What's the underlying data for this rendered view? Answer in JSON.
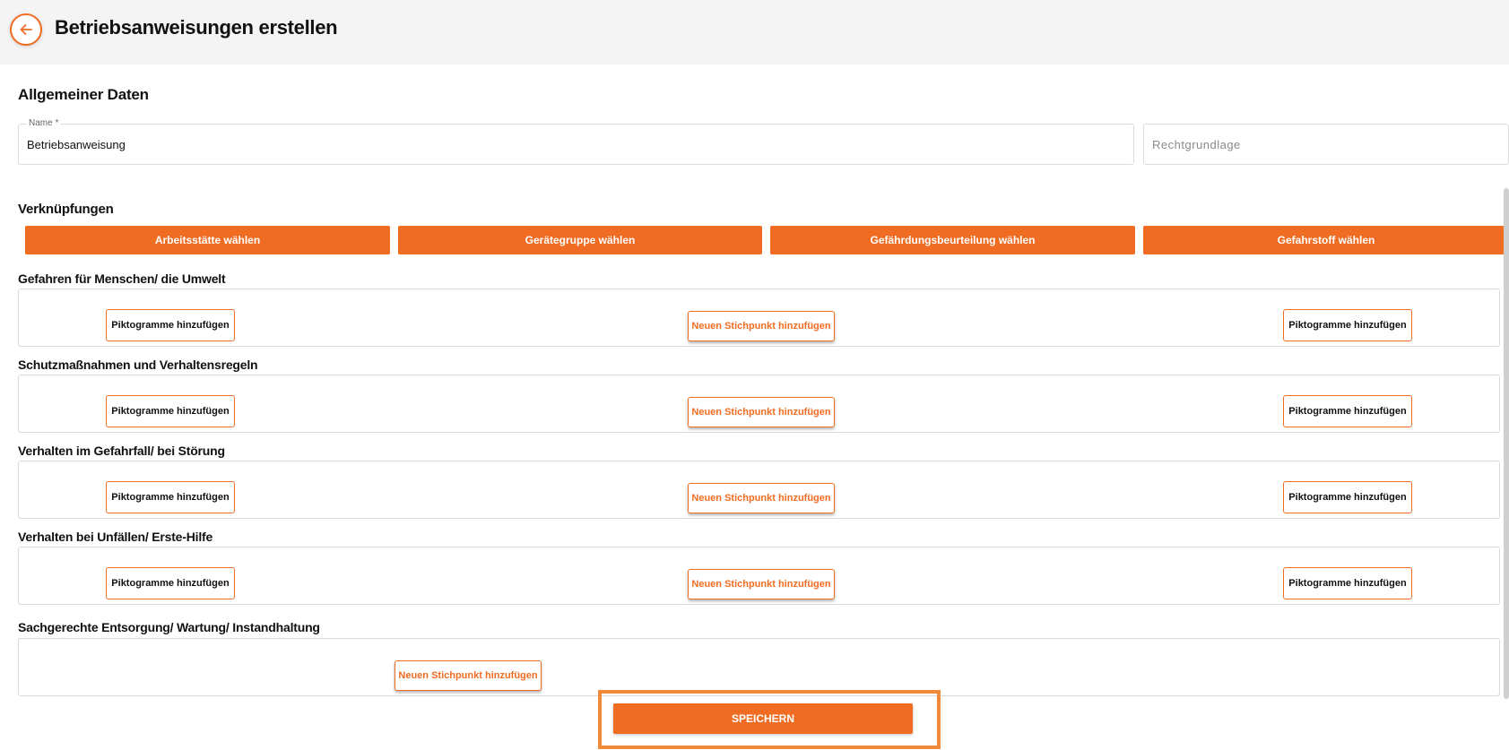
{
  "header": {
    "title": "Betriebsanweisungen erstellen"
  },
  "general": {
    "heading": "Allgemeiner Daten",
    "name_label": "Name *",
    "name_value": "Betriebsanweisung",
    "legal_placeholder": "Rechtgrundlage"
  },
  "links": {
    "heading": "Verknüpfungen",
    "buttons": [
      "Arbeitsstätte wählen",
      "Gerätegruppe wählen",
      "Gefährdungsbeurteilung wählen",
      "Gefahrstoff wählen"
    ]
  },
  "sections": [
    {
      "title": "Gefahren für Menschen/ die Umwelt",
      "picto_left": "Piktogramme hinzufügen",
      "add_point": "Neuen Stichpunkt hinzufügen",
      "picto_right": "Piktogramme hinzufügen"
    },
    {
      "title": "Schutzmaßnahmen und Verhaltensregeln",
      "picto_left": "Piktogramme hinzufügen",
      "add_point": "Neuen Stichpunkt hinzufügen",
      "picto_right": "Piktogramme hinzufügen"
    },
    {
      "title": "Verhalten im Gefahrfall/ bei Störung",
      "picto_left": "Piktogramme hinzufügen",
      "add_point": "Neuen Stichpunkt hinzufügen",
      "picto_right": "Piktogramme hinzufügen"
    },
    {
      "title": "Verhalten bei Unfällen/ Erste-Hilfe",
      "picto_left": "Piktogramme hinzufügen",
      "add_point": "Neuen Stichpunkt hinzufügen",
      "picto_right": "Piktogramme hinzufügen"
    },
    {
      "title": "Sachgerechte Entsorgung/ Wartung/ Instandhaltung",
      "add_point": "Neuen Stichpunkt hinzufügen"
    }
  ],
  "save_label": "SPEICHERN",
  "colors": {
    "accent": "#f06c22",
    "header_bg": "#f4f4f4",
    "highlight_frame": "#f08a3a"
  },
  "icons": {
    "back": "arrow-left-icon"
  }
}
